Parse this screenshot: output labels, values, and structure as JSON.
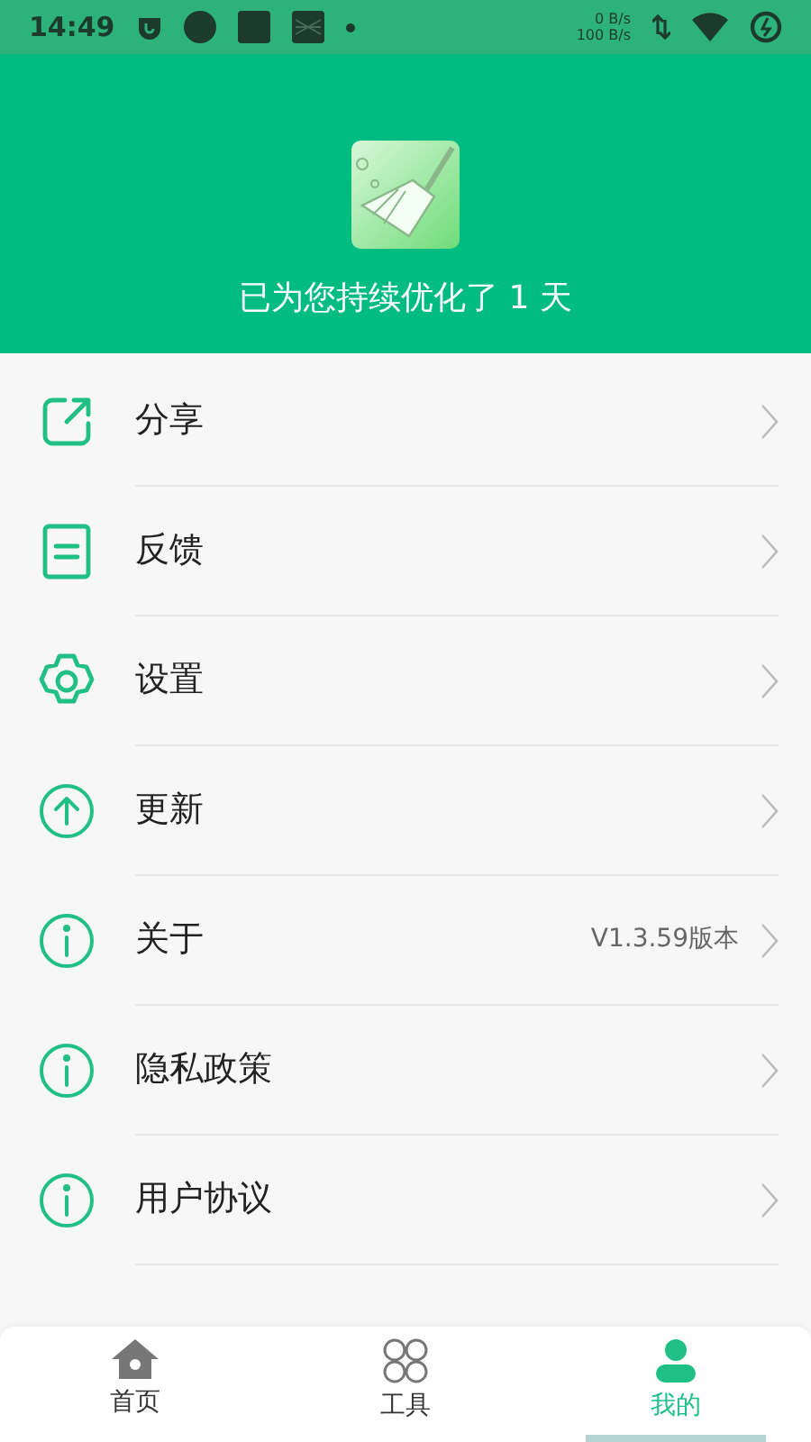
{
  "status_bar": {
    "time": "14:49",
    "upload": "0 B/s",
    "download": "100 B/s"
  },
  "header": {
    "caption": "已为您持续优化了 1 天"
  },
  "menu": [
    {
      "kind": "share",
      "label": "分享"
    },
    {
      "kind": "feedback",
      "label": "反馈"
    },
    {
      "kind": "settings",
      "label": "设置"
    },
    {
      "kind": "update",
      "label": "更新"
    },
    {
      "kind": "info",
      "label": "关于",
      "value": "V1.3.59版本"
    },
    {
      "kind": "info",
      "label": "隐私政策"
    },
    {
      "kind": "info",
      "label": "用户协议"
    }
  ],
  "tabs": [
    {
      "kind": "home",
      "label": "首页",
      "selected": false
    },
    {
      "kind": "tools",
      "label": "工具",
      "selected": false
    },
    {
      "kind": "me",
      "label": "我的",
      "selected": true
    }
  ]
}
